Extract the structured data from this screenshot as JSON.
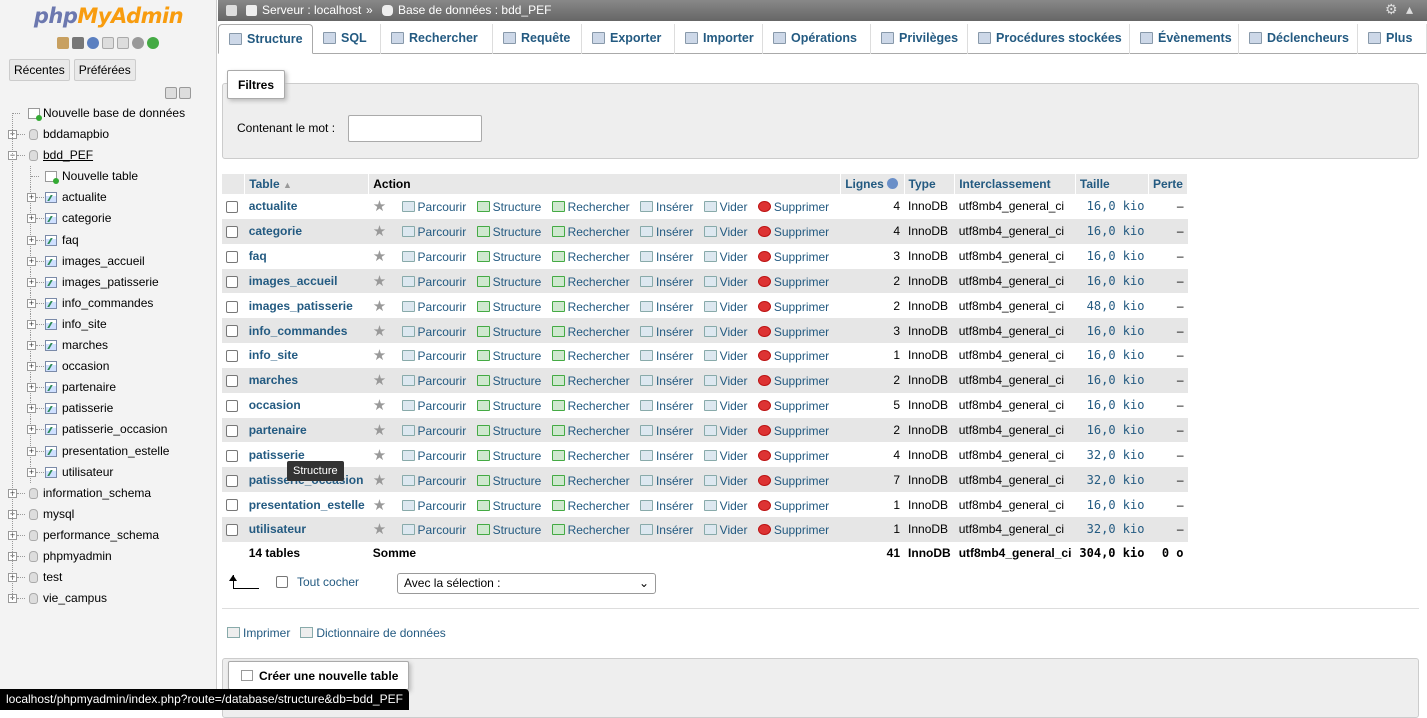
{
  "logo": {
    "php": "php",
    "my": "MyAdmin"
  },
  "nav": {
    "recent": "Récentes",
    "favorites": "Préférées"
  },
  "tree": {
    "new_db": "Nouvelle base de données",
    "databases_before": [
      "bddamapbio"
    ],
    "current_db": "bdd_PEF",
    "new_table": "Nouvelle table",
    "tables": [
      "actualite",
      "categorie",
      "faq",
      "images_accueil",
      "images_patisserie",
      "info_commandes",
      "info_site",
      "marches",
      "occasion",
      "partenaire",
      "patisserie",
      "patisserie_occasion",
      "presentation_estelle",
      "utilisateur"
    ],
    "databases_after": [
      "information_schema",
      "mysql",
      "performance_schema",
      "phpmyadmin",
      "test",
      "vie_campus"
    ]
  },
  "breadcrumb": {
    "server": "Serveur : localhost",
    "sep": "»",
    "database": "Base de données : bdd_PEF"
  },
  "tabs": [
    "Structure",
    "SQL",
    "Rechercher",
    "Requête",
    "Exporter",
    "Importer",
    "Opérations",
    "Privilèges",
    "Procédures stockées",
    "Évènements",
    "Déclencheurs",
    "Plus"
  ],
  "filter": {
    "legend": "Filtres",
    "label": "Contenant le mot :"
  },
  "table": {
    "headers": {
      "table": "Table",
      "action": "Action",
      "rows": "Lignes",
      "type": "Type",
      "collation": "Interclassement",
      "size": "Taille",
      "overhead": "Perte"
    },
    "actions": {
      "browse": "Parcourir",
      "structure": "Structure",
      "search": "Rechercher",
      "insert": "Insérer",
      "empty": "Vider",
      "drop": "Supprimer"
    },
    "rows": [
      {
        "name": "actualite",
        "rows": "4",
        "type": "InnoDB",
        "collation": "utf8mb4_general_ci",
        "size": "16,0 kio",
        "overhead": "–"
      },
      {
        "name": "categorie",
        "rows": "4",
        "type": "InnoDB",
        "collation": "utf8mb4_general_ci",
        "size": "16,0 kio",
        "overhead": "–"
      },
      {
        "name": "faq",
        "rows": "3",
        "type": "InnoDB",
        "collation": "utf8mb4_general_ci",
        "size": "16,0 kio",
        "overhead": "–"
      },
      {
        "name": "images_accueil",
        "rows": "2",
        "type": "InnoDB",
        "collation": "utf8mb4_general_ci",
        "size": "16,0 kio",
        "overhead": "–"
      },
      {
        "name": "images_patisserie",
        "rows": "2",
        "type": "InnoDB",
        "collation": "utf8mb4_general_ci",
        "size": "48,0 kio",
        "overhead": "–"
      },
      {
        "name": "info_commandes",
        "rows": "3",
        "type": "InnoDB",
        "collation": "utf8mb4_general_ci",
        "size": "16,0 kio",
        "overhead": "–"
      },
      {
        "name": "info_site",
        "rows": "1",
        "type": "InnoDB",
        "collation": "utf8mb4_general_ci",
        "size": "16,0 kio",
        "overhead": "–"
      },
      {
        "name": "marches",
        "rows": "2",
        "type": "InnoDB",
        "collation": "utf8mb4_general_ci",
        "size": "16,0 kio",
        "overhead": "–"
      },
      {
        "name": "occasion",
        "rows": "5",
        "type": "InnoDB",
        "collation": "utf8mb4_general_ci",
        "size": "16,0 kio",
        "overhead": "–"
      },
      {
        "name": "partenaire",
        "rows": "2",
        "type": "InnoDB",
        "collation": "utf8mb4_general_ci",
        "size": "16,0 kio",
        "overhead": "–"
      },
      {
        "name": "patisserie",
        "rows": "4",
        "type": "InnoDB",
        "collation": "utf8mb4_general_ci",
        "size": "32,0 kio",
        "overhead": "–"
      },
      {
        "name": "patisserie_occasion",
        "rows": "7",
        "type": "InnoDB",
        "collation": "utf8mb4_general_ci",
        "size": "32,0 kio",
        "overhead": "–"
      },
      {
        "name": "presentation_estelle",
        "rows": "1",
        "type": "InnoDB",
        "collation": "utf8mb4_general_ci",
        "size": "16,0 kio",
        "overhead": "–"
      },
      {
        "name": "utilisateur",
        "rows": "1",
        "type": "InnoDB",
        "collation": "utf8mb4_general_ci",
        "size": "32,0 kio",
        "overhead": "–"
      }
    ],
    "footer": {
      "count": "14 tables",
      "sum": "Somme",
      "rows": "41",
      "type": "InnoDB",
      "collation": "utf8mb4_general_ci",
      "size": "304,0 kio",
      "overhead": "0 o"
    }
  },
  "bulk": {
    "check_all": "Tout cocher",
    "with_selected": "Avec la sélection :"
  },
  "links": {
    "print": "Imprimer",
    "dictionary": "Dictionnaire de données"
  },
  "create_table": {
    "legend": "Créer une nouvelle table"
  },
  "tooltip": "Structure",
  "status_url": "localhost/phpmyadmin/index.php?route=/database/structure&db=bdd_PEF",
  "colors": {
    "link": "#235a81",
    "logo_php": "#6c78af",
    "logo_myadmin": "#f89c0e"
  }
}
